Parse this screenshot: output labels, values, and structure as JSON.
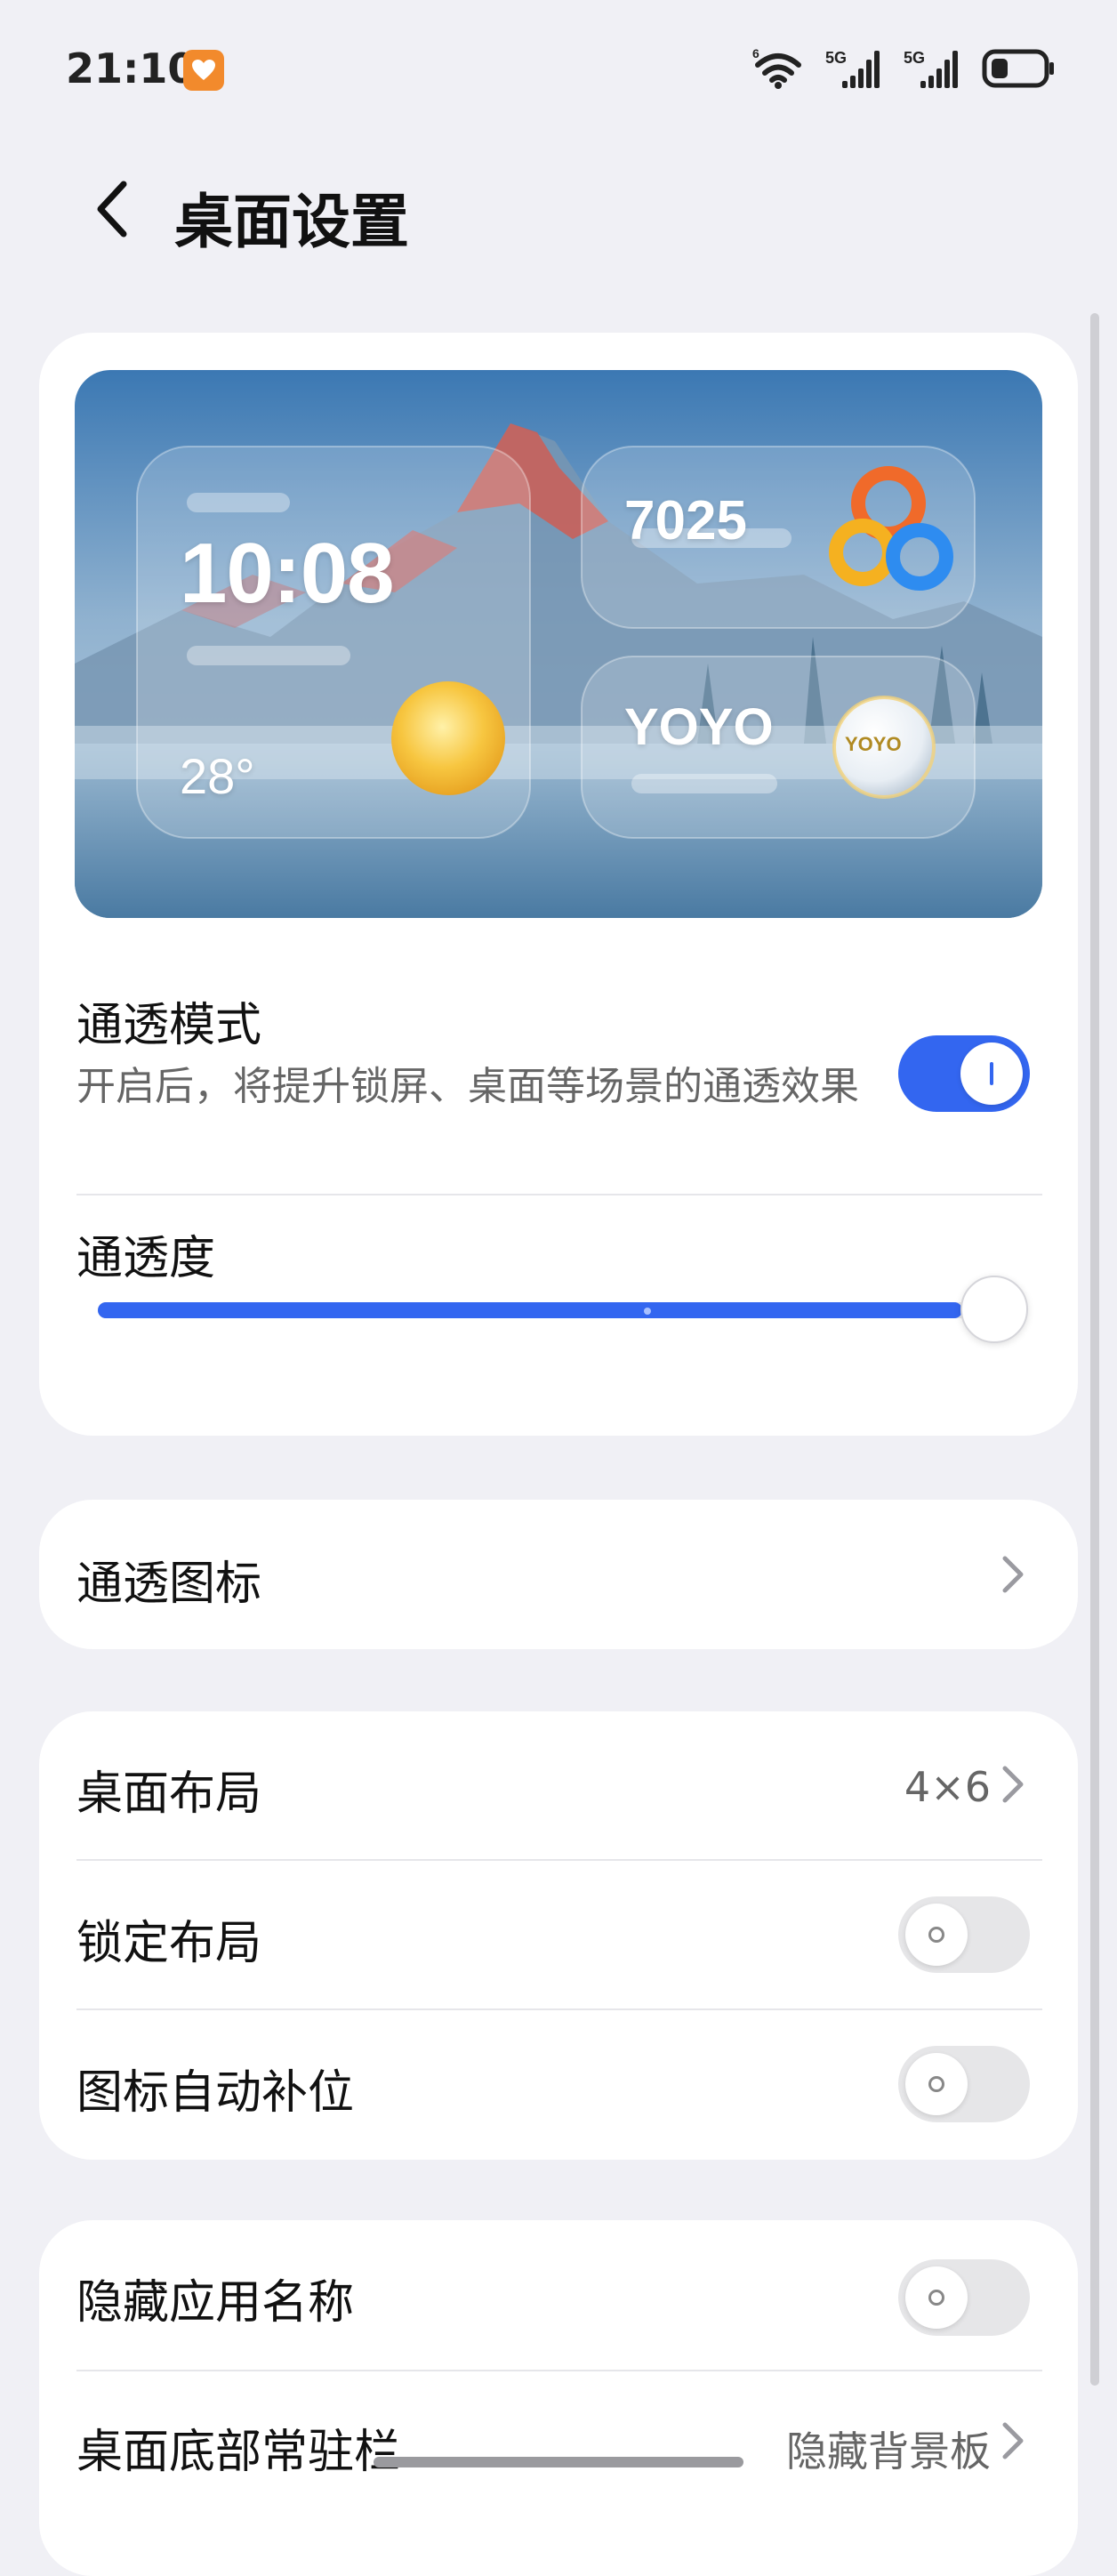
{
  "status_bar": {
    "time": "21:10",
    "heart_icon": "heart-app-icon",
    "icons": [
      "wifi-6-icon",
      "signal-5g-icon",
      "signal-5g-icon",
      "battery-icon"
    ],
    "network_labels": [
      "5G",
      "5G"
    ],
    "wifi_label": "6"
  },
  "header": {
    "title": "桌面设置",
    "back_icon": "chevron-left-icon"
  },
  "preview": {
    "clock": "10:08",
    "temperature": "28°",
    "steps": "7025",
    "yoyo_label": "YOYO",
    "yoyo_ball_text": "YOYO"
  },
  "transparency": {
    "mode_label": "通透模式",
    "mode_desc": "开启后，将提升锁屏、桌面等场景的通透效果",
    "mode_enabled": true,
    "level_label": "通透度",
    "level_value": 1.0
  },
  "icons_row": {
    "label": "通透图标"
  },
  "layout_group": {
    "layout_label": "桌面布局",
    "layout_value": "4×6",
    "lock_label": "锁定布局",
    "lock_enabled": false,
    "autofill_label": "图标自动补位",
    "autofill_enabled": false
  },
  "bottom_group": {
    "hide_names_label": "隐藏应用名称",
    "hide_names_enabled": false,
    "dock_label": "桌面底部常驻栏",
    "dock_value": "隐藏背景板"
  },
  "colors": {
    "accent": "#3366f0",
    "background": "#f0f0f5",
    "card": "#ffffff"
  }
}
